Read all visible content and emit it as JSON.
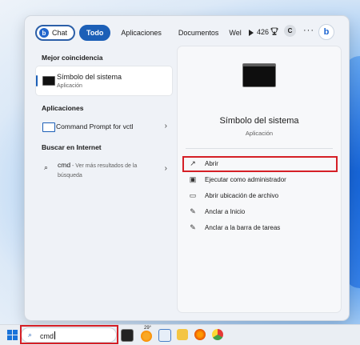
{
  "topbar": {
    "chat_label": "Chat",
    "tabs": [
      "Todo",
      "Aplicaciones",
      "Documentos",
      "Wel"
    ],
    "counter": "426",
    "avatar_letter": "C",
    "more": "···"
  },
  "left": {
    "best_match_header": "Mejor coincidencia",
    "best_match": {
      "title": "Símbolo del sistema",
      "subtitle": "Aplicación"
    },
    "apps_header": "Aplicaciones",
    "apps": [
      {
        "label": "Command Prompt for vctl"
      }
    ],
    "web_header": "Buscar en Internet",
    "web": {
      "query": "cmd",
      "hint": " - Ver más resultados de la búsqueda"
    }
  },
  "right": {
    "title": "Símbolo del sistema",
    "subtitle": "Aplicación",
    "actions": [
      {
        "label": "Abrir",
        "icon": "open-icon"
      },
      {
        "label": "Ejecutar como administrador",
        "icon": "shield-icon"
      },
      {
        "label": "Abrir ubicación de archivo",
        "icon": "folder-icon"
      },
      {
        "label": "Anclar a Inicio",
        "icon": "pin-icon"
      },
      {
        "label": "Anclar a la barra de tareas",
        "icon": "pin-icon"
      }
    ]
  },
  "taskbar": {
    "search_value": "cmd",
    "weather_temp": "29°"
  },
  "colors": {
    "accent": "#1c5fb7",
    "highlight_box": "#d51f26"
  }
}
